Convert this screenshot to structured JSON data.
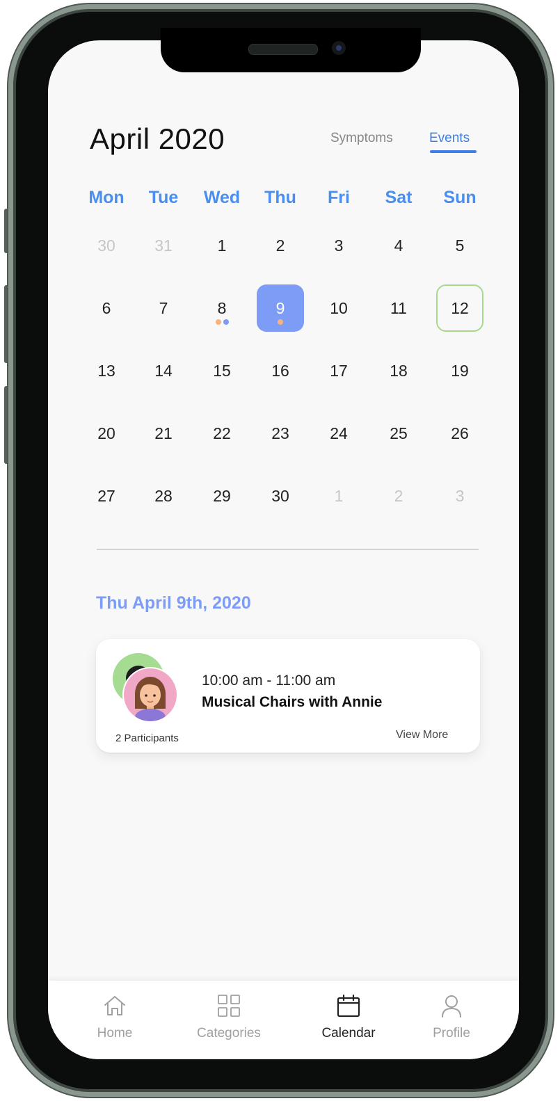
{
  "header": {
    "month_title": "April 2020"
  },
  "tabs": [
    {
      "label": "Symptoms",
      "active": false
    },
    {
      "label": "Events",
      "active": true
    }
  ],
  "colors": {
    "accent_blue": "#3f7fe6",
    "selected_day": "#7d9cf6",
    "today_border": "#a7d88e",
    "dot_orange": "#f6b47c",
    "dot_blue": "#7d9cf6"
  },
  "calendar": {
    "weekdays": [
      "Mon",
      "Tue",
      "Wed",
      "Thu",
      "Fri",
      "Sat",
      "Sun"
    ],
    "weeks": [
      [
        {
          "d": "30",
          "muted": true
        },
        {
          "d": "31",
          "muted": true
        },
        {
          "d": "1"
        },
        {
          "d": "2"
        },
        {
          "d": "3"
        },
        {
          "d": "4"
        },
        {
          "d": "5"
        }
      ],
      [
        {
          "d": "6"
        },
        {
          "d": "7"
        },
        {
          "d": "8",
          "dots": [
            "orange",
            "blue"
          ]
        },
        {
          "d": "9",
          "selected": true,
          "dots": [
            "orange"
          ]
        },
        {
          "d": "10"
        },
        {
          "d": "11"
        },
        {
          "d": "12",
          "today": true
        }
      ],
      [
        {
          "d": "13"
        },
        {
          "d": "14"
        },
        {
          "d": "15"
        },
        {
          "d": "16"
        },
        {
          "d": "17"
        },
        {
          "d": "18"
        },
        {
          "d": "19"
        }
      ],
      [
        {
          "d": "20"
        },
        {
          "d": "21"
        },
        {
          "d": "22"
        },
        {
          "d": "23"
        },
        {
          "d": "24"
        },
        {
          "d": "25"
        },
        {
          "d": "26"
        }
      ],
      [
        {
          "d": "27"
        },
        {
          "d": "28"
        },
        {
          "d": "29"
        },
        {
          "d": "30"
        },
        {
          "d": "1",
          "muted": true
        },
        {
          "d": "2",
          "muted": true
        },
        {
          "d": "3",
          "muted": true
        }
      ]
    ]
  },
  "selected_date_label": "Thu April 9th, 2020",
  "event": {
    "time": "10:00 am - 11:00 am",
    "title": "Musical Chairs with Annie",
    "participants_label": "2 Participants",
    "view_more_label": "View More"
  },
  "bottom_nav": [
    {
      "label": "Home",
      "icon": "home-icon",
      "active": false
    },
    {
      "label": "Categories",
      "icon": "categories-grid-icon",
      "active": false
    },
    {
      "label": "Calendar",
      "icon": "calendar-icon",
      "active": true
    },
    {
      "label": "Profile",
      "icon": "profile-icon",
      "active": false
    }
  ]
}
